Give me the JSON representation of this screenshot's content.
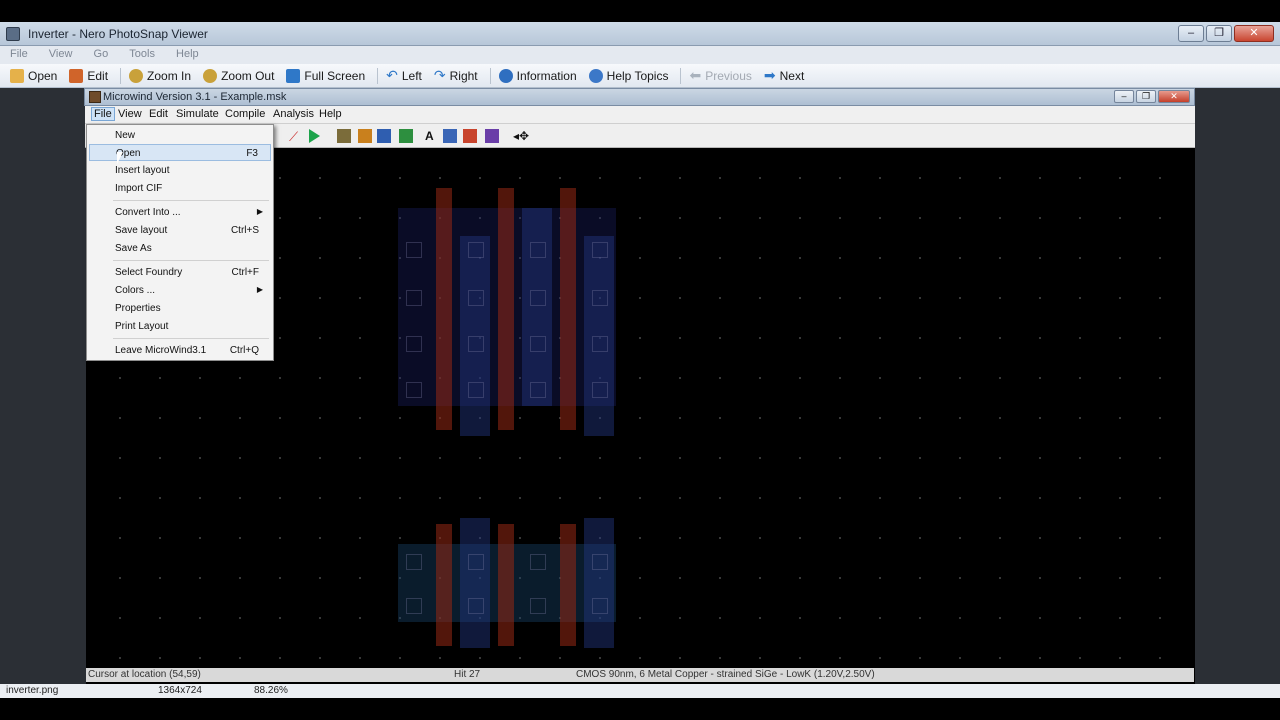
{
  "outer_window": {
    "title": "Inverter - Nero PhotoSnap Viewer",
    "menu": [
      "File",
      "View",
      "Go",
      "Tools",
      "Help"
    ],
    "toolbar": [
      {
        "label": "Open",
        "icon": "open-folder-icon",
        "enabled": true
      },
      {
        "label": "Edit",
        "icon": "edit-icon",
        "enabled": true
      },
      {
        "label": "Zoom In",
        "icon": "zoom-in-icon",
        "enabled": true
      },
      {
        "label": "Zoom Out",
        "icon": "zoom-out-icon",
        "enabled": true
      },
      {
        "label": "Full Screen",
        "icon": "full-screen-icon",
        "enabled": true
      },
      {
        "label": "Left",
        "icon": "rotate-left-icon",
        "enabled": true
      },
      {
        "label": "Right",
        "icon": "rotate-right-icon",
        "enabled": true
      },
      {
        "label": "Information",
        "icon": "info-icon",
        "enabled": true
      },
      {
        "label": "Help Topics",
        "icon": "help-icon",
        "enabled": true
      },
      {
        "label": "Previous",
        "icon": "arrow-left-icon",
        "enabled": false
      },
      {
        "label": "Next",
        "icon": "arrow-right-icon",
        "enabled": true
      }
    ],
    "status": {
      "filename": "inverter.png",
      "dimensions": "1364x724",
      "zoom": "88.26%"
    }
  },
  "microwind": {
    "title": "Microwind Version 3.1 - Example.msk",
    "menu": [
      "File",
      "View",
      "Edit",
      "Simulate",
      "Compile",
      "Analysis",
      "Help"
    ],
    "status": {
      "cursor": "Cursor at location (54,59)",
      "hit": "Hit 27",
      "technology": "CMOS 90nm, 6 Metal Copper - strained SiGe - LowK (1.20V,2.50V)"
    }
  },
  "file_menu": [
    {
      "label": "New",
      "shortcut": "",
      "submenu": false
    },
    {
      "label": "Open",
      "shortcut": "F3",
      "submenu": false,
      "highlighted": true
    },
    {
      "label": "Insert layout",
      "shortcut": "",
      "submenu": false
    },
    {
      "label": "Import CIF",
      "shortcut": "",
      "submenu": false
    },
    {
      "label": "Convert Into ...",
      "shortcut": "",
      "submenu": true
    },
    {
      "label": "Save layout",
      "shortcut": "Ctrl+S",
      "submenu": false
    },
    {
      "label": "Save As",
      "shortcut": "",
      "submenu": false
    },
    {
      "label": "Select Foundry",
      "shortcut": "Ctrl+F",
      "submenu": false
    },
    {
      "label": "Colors ...",
      "shortcut": "",
      "submenu": true
    },
    {
      "label": "Properties",
      "shortcut": "",
      "submenu": false
    },
    {
      "label": "Print Layout",
      "shortcut": "",
      "submenu": false
    },
    {
      "label": "Leave MicroWind3.1",
      "shortcut": "Ctrl+Q",
      "submenu": false
    }
  ],
  "colors": {
    "canvas": "#000000",
    "poly": "#a8321c",
    "diffusion": "#1c2a7a",
    "metal": "#2b4d8a"
  }
}
